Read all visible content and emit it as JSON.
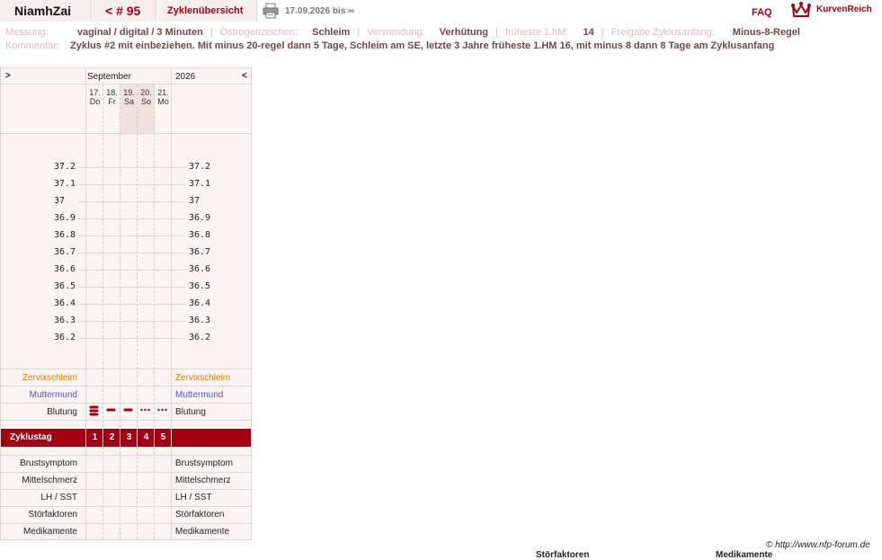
{
  "header": {
    "username": "NiamhZai",
    "cycle_nav": "< # 95",
    "overview": "Zyklenübersicht",
    "date_range": "17.09.2026 bis ∞",
    "faq": "FAQ",
    "brand": "KurvenReich"
  },
  "meta": {
    "messung_label": "Messung:",
    "messung_value": "vaginal / digital / 3 Minuten",
    "oestrogen_label": "Östrogenzeichen:",
    "oestrogen_value": "Schleim",
    "verwendung_label": "Verwendung:",
    "verwendung_value": "Verhütung",
    "fruehest_label": "früheste 1.hM:",
    "fruehest_value": "14",
    "freigabe_label": "Freigabe Zyklusanfang:",
    "freigabe_value": "Minus-8-Regel",
    "kommentar_label": "Kommentar:",
    "kommentar_value": "Zyklus #2  mit einbeziehen. Mit minus 20-regel dann 5 Tage,  Schleim am SE, letzte 3 Jahre früheste 1.HM 16, mit minus 8 dann 8 Tage am Zyklusanfang"
  },
  "chart_nav": {
    "prev": ">",
    "next": "<",
    "month": "September",
    "year": "2026"
  },
  "days": [
    {
      "num": "17.",
      "dow": "Do"
    },
    {
      "num": "18.",
      "dow": "Fr"
    },
    {
      "num": "19.",
      "dow": "Sa"
    },
    {
      "num": "20.",
      "dow": "So"
    },
    {
      "num": "21.",
      "dow": "Mo"
    }
  ],
  "temp_ticks_left": [
    "37.2",
    "37.1",
    "37",
    "36.9",
    "36.8",
    "36.7",
    "36.6",
    "36.5",
    "36.4",
    "36.3",
    "36.2"
  ],
  "temp_ticks_right": [
    "37.2",
    "37.1",
    "37",
    "36.9",
    "36.8",
    "36.7",
    "36.6",
    "36.5",
    "36.4",
    "36.3",
    "36.2"
  ],
  "rows": {
    "zervix": "Zervixschleim",
    "muttermund": "Muttermund",
    "blutung": "Blutung",
    "zyklustag": "Zyklustag",
    "brust": "Brustsymptom",
    "mittelschmerz": "Mittelschmerz",
    "lh": "LH / SST",
    "stoer": "Störfaktoren",
    "medi": "Medikamente"
  },
  "zyklustage": [
    "1",
    "2",
    "3",
    "4",
    "5"
  ],
  "bleeding": [
    "heavy",
    "medium",
    "medium",
    "light",
    "light"
  ],
  "colors": {
    "accent": "#a30014",
    "zervix": "#e67e00",
    "muttermund": "#4a55c8"
  },
  "footer": {
    "copyright": "© http://www.nfp-forum.de",
    "cut_stoer": "Störfaktoren",
    "cut_medi": "Medikamente"
  }
}
